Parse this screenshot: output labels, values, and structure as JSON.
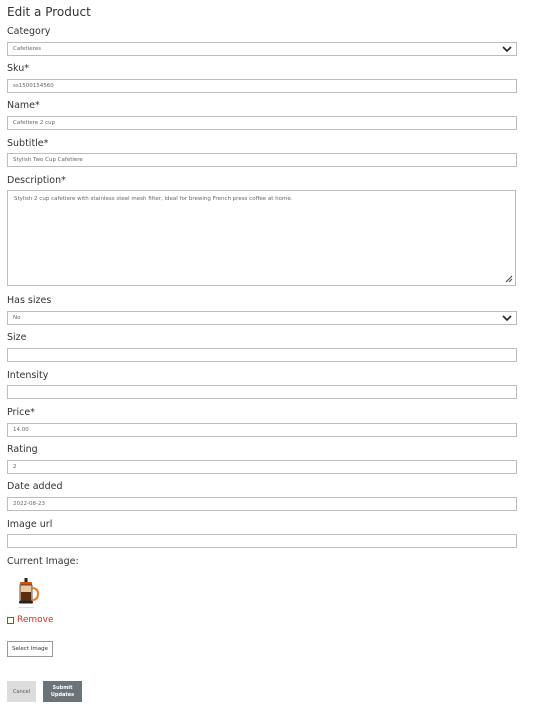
{
  "title": "Edit a Product",
  "fields": {
    "category": {
      "label": "Category",
      "value": "Cafetieres",
      "icon": "chevron-down-icon"
    },
    "sku": {
      "label": "Sku*",
      "value": "ss1500154560"
    },
    "name": {
      "label": "Name*",
      "value": "Cafetiere 2 cup"
    },
    "subtitle": {
      "label": "Subtitle*",
      "value": "Stylish Two Cup Cafetiere"
    },
    "description": {
      "label": "Description*",
      "value": "Stylish 2 cup cafetiere with stainless steel mesh filter, ideal for brewing French press coffee at home."
    },
    "has_sizes": {
      "label": "Has sizes",
      "value": "No",
      "icon": "chevron-down-icon"
    },
    "size": {
      "label": "Size",
      "value": ""
    },
    "intensity": {
      "label": "Intensity",
      "value": ""
    },
    "price": {
      "label": "Price*",
      "value": "14.00"
    },
    "rating": {
      "label": "Rating",
      "value": "2"
    },
    "date_added": {
      "label": "Date added",
      "value": "2022-08-23"
    },
    "image_url": {
      "label": "Image url",
      "value": ""
    }
  },
  "current_image": {
    "label": "Current Image:",
    "remove_label": "Remove"
  },
  "buttons": {
    "select_image": "Select Image",
    "cancel": "Cancel",
    "submit": "Submit Updates"
  },
  "colors": {
    "remove": "#c0392b",
    "submit_bg": "#6b7478",
    "cancel_bg": "#dcdcdc"
  }
}
